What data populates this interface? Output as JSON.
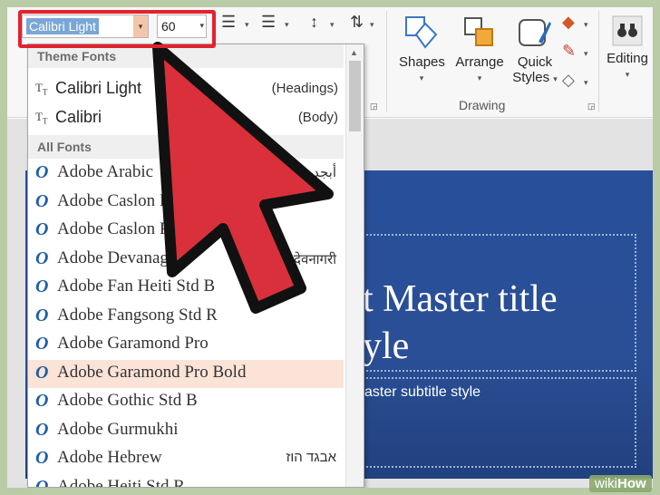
{
  "toolbar": {
    "font_name": "Calibri Light",
    "font_size": "60",
    "shapes_label": "Shapes",
    "arrange_label": "Arrange",
    "quick_styles_label_1": "Quick",
    "quick_styles_label_2": "Styles",
    "editing_label": "Editing",
    "drawing_group_label": "Drawing"
  },
  "font_dropdown": {
    "theme_fonts_header": "Theme Fonts",
    "theme_fonts": [
      {
        "name": "Calibri Light",
        "role": "(Headings)"
      },
      {
        "name": "Calibri",
        "role": "(Body)"
      }
    ],
    "all_fonts_header": "All Fonts",
    "fonts": [
      {
        "name": "Adobe Arabic",
        "sample": "أبجد هوز"
      },
      {
        "name": "Adobe Caslon Pro",
        "sample": ""
      },
      {
        "name": "Adobe Caslon Pro Bold",
        "sample": ""
      },
      {
        "name": "Adobe Devanagari",
        "sample": "देवनागरी"
      },
      {
        "name": "Adobe Fan Heiti Std B",
        "sample": ""
      },
      {
        "name": "Adobe Fangsong Std R",
        "sample": ""
      },
      {
        "name": "Adobe Garamond Pro",
        "sample": ""
      },
      {
        "name": "Adobe Garamond Pro Bold",
        "sample": ""
      },
      {
        "name": "Adobe Gothic Std B",
        "sample": ""
      },
      {
        "name": "Adobe Gurmukhi",
        "sample": ""
      },
      {
        "name": "Adobe Hebrew",
        "sample": "אבגד הוז"
      },
      {
        "name": "Adobe Heiti Std R",
        "sample": ""
      }
    ],
    "selected_index": 7
  },
  "slide": {
    "title": "Click to edit Master title style",
    "title_visible": "t Master title\nyle",
    "subtitle_visible": "aster subtitle style"
  },
  "watermark": {
    "prefix": "wiki",
    "suffix": "How"
  },
  "colors": {
    "highlight": "#e3222e",
    "arrow_fill": "#d9303b",
    "slide_blue": "#284f9a",
    "selected_row": "#fbe3d8"
  }
}
